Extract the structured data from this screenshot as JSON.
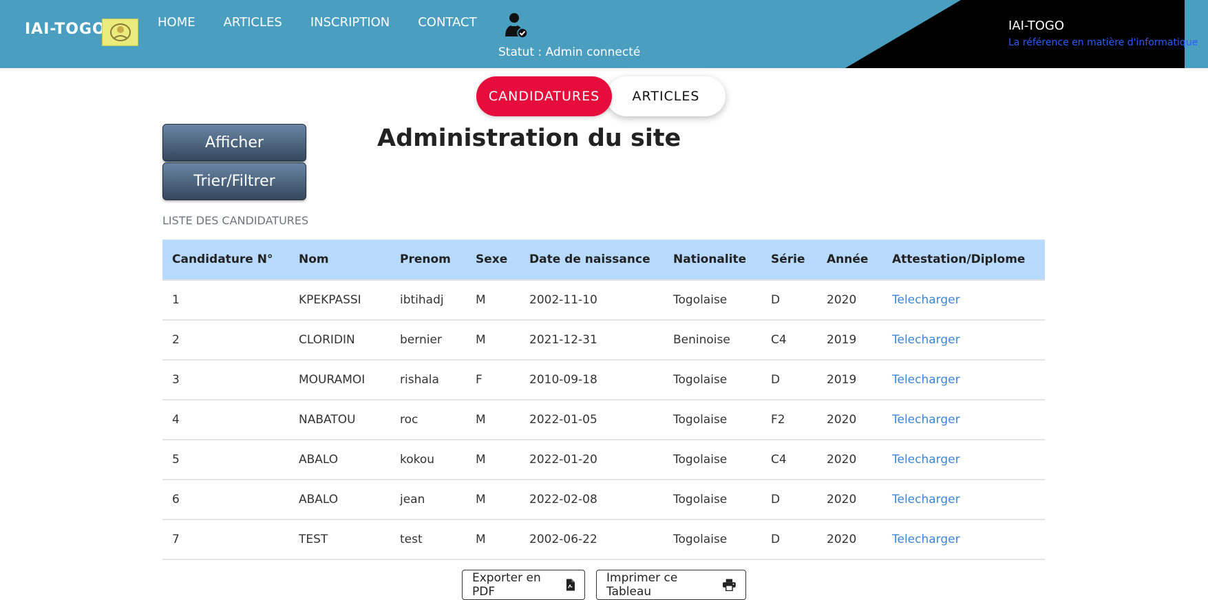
{
  "header": {
    "brand": "IAI-TOGO",
    "nav": [
      {
        "label": "HOME"
      },
      {
        "label": "ARTICLES"
      },
      {
        "label": "INSCRIPTION"
      },
      {
        "label": "CONTACT"
      }
    ],
    "status": "Statut : Admin connecté",
    "user_icon": "user-check-icon",
    "site_title": "IAI-TOGO",
    "site_subtitle": "La référence en matière d'informatique"
  },
  "tabs": [
    {
      "label": "CANDIDATURES",
      "active": true
    },
    {
      "label": "ARTICLES",
      "active": false
    }
  ],
  "sidebar": {
    "afficher": "Afficher",
    "trier": "Trier/Filtrer"
  },
  "page_title": "Administration du site",
  "list_title": "LISTE DES CANDIDATURES",
  "table": {
    "columns": [
      "Candidature N°",
      "Nom",
      "Prenom",
      "Sexe",
      "Date de naissance",
      "Nationalite",
      "Série",
      "Année",
      "Attestation/Diplome"
    ],
    "rows": [
      [
        "1",
        "KPEKPASSI",
        "ibtihadj",
        "M",
        "2002-11-10",
        "Togolaise",
        "D",
        "2020",
        "Telecharger"
      ],
      [
        "2",
        "CLORIDIN",
        "bernier",
        "M",
        "2021-12-31",
        "Beninoise",
        "C4",
        "2019",
        "Telecharger"
      ],
      [
        "3",
        "MOURAMOI",
        "rishala",
        "F",
        "2010-09-18",
        "Togolaise",
        "D",
        "2019",
        "Telecharger"
      ],
      [
        "4",
        "NABATOU",
        "roc",
        "M",
        "2022-01-05",
        "Togolaise",
        "F2",
        "2020",
        "Telecharger"
      ],
      [
        "5",
        "ABALO",
        "kokou",
        "M",
        "2022-01-20",
        "Togolaise",
        "C4",
        "2020",
        "Telecharger"
      ],
      [
        "6",
        "ABALO",
        "jean",
        "M",
        "2022-02-08",
        "Togolaise",
        "D",
        "2020",
        "Telecharger"
      ],
      [
        "7",
        "TEST",
        "test",
        "M",
        "2002-06-22",
        "Togolaise",
        "D",
        "2020",
        "Telecharger"
      ]
    ]
  },
  "actions": {
    "export_pdf": "Exporter en PDF",
    "print_table": "Imprimer ce Tableau"
  },
  "colors": {
    "header_bg": "#4a9fc1",
    "tab_active": "#e60c3c",
    "table_head": "#b8daff",
    "link": "#3c86d6"
  }
}
